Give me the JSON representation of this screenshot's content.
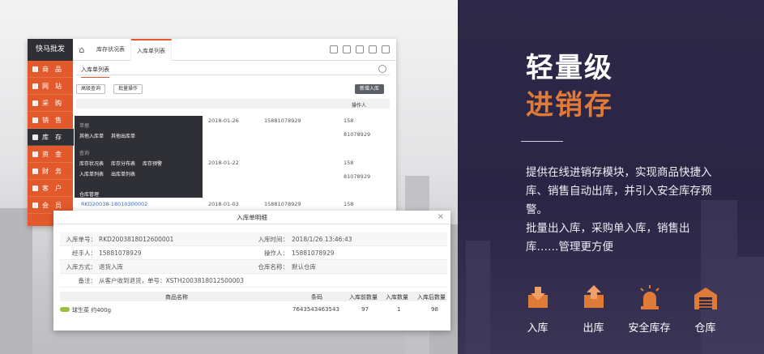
{
  "app": {
    "logo": "快马批发",
    "sidebar": [
      {
        "label": "商　品",
        "active": false
      },
      {
        "label": "网　站",
        "active": false
      },
      {
        "label": "采　购",
        "active": false
      },
      {
        "label": "销　售",
        "active": false
      },
      {
        "label": "库　存",
        "active": true
      },
      {
        "label": "资　金",
        "active": false
      },
      {
        "label": "财　务",
        "active": false
      },
      {
        "label": "客　户",
        "active": false
      },
      {
        "label": "会　员",
        "active": false
      }
    ],
    "tabs": [
      "库存状况表",
      "入库单列表"
    ],
    "subtab": "入库单列表",
    "buttons": {
      "advanced": "高级查询",
      "batch": "批量操作",
      "new": "新增入库"
    },
    "header": {
      "handler": "操作人"
    },
    "rows": [
      {
        "date": "2018-01-26",
        "phone": "15881078929",
        "op_a": "158",
        "op_b": "81078929"
      },
      {
        "date": "2018-01-22",
        "phone": "",
        "op_a": "158",
        "op_b": "81078929"
      },
      {
        "id": "RKD20038-18010300002",
        "date": "2018-01-03",
        "phone": "15881078929",
        "op_a": "158",
        "op_b": ""
      }
    ],
    "menu": {
      "g1": "单据",
      "g1_items": [
        "其他入库单",
        "其他出库单"
      ],
      "g2": "查询",
      "g2_row1": [
        "库存状况表",
        "库存分布表",
        "库存预警"
      ],
      "g2_row2": [
        "入库单列表",
        "出库单列表"
      ],
      "manage": "仓库管理"
    }
  },
  "dialog": {
    "title": "入库单明细",
    "close": "×",
    "fields": {
      "no_label": "入库单号：",
      "no": "RKD2003818012600001",
      "time_label": "入库时间：",
      "time": "2018/1/26 13:46:43",
      "handler_label": "经手人：",
      "handler": "15881078929",
      "operator_label": "操作人：",
      "operator": "15881078929",
      "method_label": "入库方式：",
      "method": "退货入库",
      "warehouse_label": "仓库名称：",
      "warehouse": "默认仓库",
      "note_label": "备注：",
      "note": "从客户收到退货，单号：XSTH2003818012500003"
    },
    "grid_headers": [
      "商品名称",
      "条码",
      "入库前数量",
      "入库数量",
      "入库后数量"
    ],
    "grid_row": {
      "name": "球生菜 约400g",
      "barcode": "7643543463543",
      "before": "97",
      "qty": "1",
      "after": "98"
    }
  },
  "promo": {
    "title1": "轻量级",
    "title2": "进销存",
    "desc1": "提供在线进销存模块，实现商品快捷入库、销售自动出库，并引入安全库存预警。",
    "desc2": "批量出入库，采购单入库，销售出库……管理更方便",
    "features": [
      {
        "label": "入库",
        "icon": "box-in-icon"
      },
      {
        "label": "出库",
        "icon": "box-out-icon"
      },
      {
        "label": "安全库存",
        "icon": "alarm-light-icon"
      },
      {
        "label": "仓库",
        "icon": "warehouse-icon"
      }
    ],
    "accent": "#e07a38"
  }
}
